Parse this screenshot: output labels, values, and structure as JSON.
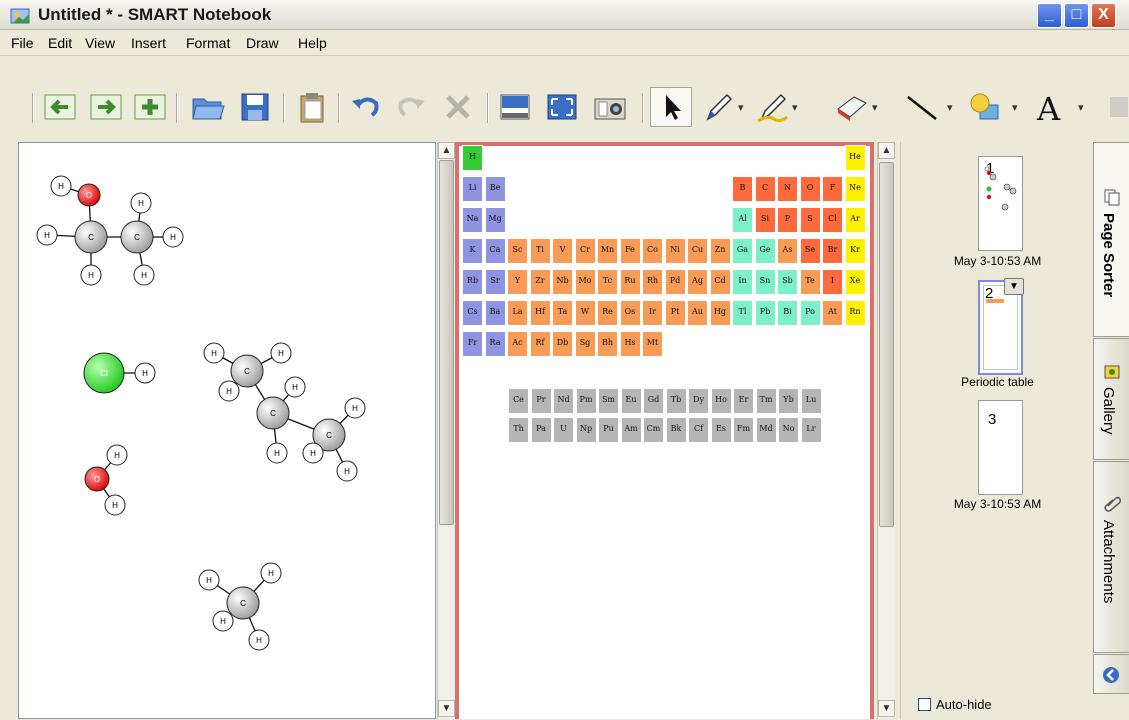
{
  "window": {
    "title": "Untitled * - SMART Notebook",
    "buttons": {
      "minimize": "_",
      "maximize": "□",
      "close": "X"
    }
  },
  "menu": [
    "File",
    "Edit",
    "View",
    "Insert",
    "Format",
    "Draw",
    "Help"
  ],
  "toolbar": {
    "icons": [
      "back-arrow-icon",
      "forward-arrow-icon",
      "add-page-icon",
      "open-folder-icon",
      "save-icon",
      "paste-icon",
      "undo-icon",
      "redo-icon",
      "delete-icon",
      "screen-shade-icon",
      "full-screen-icon",
      "capture-icon",
      "select-icon",
      "pen-icon",
      "creative-pen-icon",
      "eraser-icon",
      "line-icon",
      "shapes-icon",
      "text-icon"
    ]
  },
  "pages": [
    {
      "number": "1",
      "caption": "May 3-10:53 AM"
    },
    {
      "number": "2",
      "caption": "Periodic table"
    },
    {
      "number": "3",
      "caption": "May 3-10:53 AM"
    }
  ],
  "side_tabs": [
    "Page Sorter",
    "Gallery",
    "Attachments"
  ],
  "autohide_label": "Auto-hide",
  "molecules": {
    "h": "H",
    "c": "C",
    "o": "O",
    "cl": "Cl"
  },
  "periodic_table": {
    "main": [
      [
        {
          "s": "H",
          "c": "h",
          "col": 0
        },
        {
          "s": "He",
          "c": "n",
          "col": 17
        }
      ],
      [
        {
          "s": "Li",
          "c": "s",
          "col": 0
        },
        {
          "s": "Be",
          "c": "s",
          "col": 1
        },
        {
          "s": "B",
          "c": "p",
          "col": 12
        },
        {
          "s": "C",
          "c": "p",
          "col": 13
        },
        {
          "s": "N",
          "c": "p",
          "col": 14
        },
        {
          "s": "O",
          "c": "p",
          "col": 15
        },
        {
          "s": "F",
          "c": "p",
          "col": 16
        },
        {
          "s": "Ne",
          "c": "n",
          "col": 17
        }
      ],
      [
        {
          "s": "Na",
          "c": "s",
          "col": 0
        },
        {
          "s": "Mg",
          "c": "s",
          "col": 1
        },
        {
          "s": "Al",
          "c": "m",
          "col": 12
        },
        {
          "s": "Si",
          "c": "p",
          "col": 13
        },
        {
          "s": "P",
          "c": "p",
          "col": 14
        },
        {
          "s": "S",
          "c": "p",
          "col": 15
        },
        {
          "s": "Cl",
          "c": "p",
          "col": 16
        },
        {
          "s": "Ar",
          "c": "n",
          "col": 17
        }
      ],
      [
        {
          "s": "K",
          "c": "s",
          "col": 0
        },
        {
          "s": "Ca",
          "c": "s",
          "col": 1
        },
        {
          "s": "Sc",
          "c": "t",
          "col": 2
        },
        {
          "s": "Ti",
          "c": "t",
          "col": 3
        },
        {
          "s": "V",
          "c": "t",
          "col": 4
        },
        {
          "s": "Cr",
          "c": "t",
          "col": 5
        },
        {
          "s": "Mn",
          "c": "t",
          "col": 6
        },
        {
          "s": "Fe",
          "c": "t",
          "col": 7
        },
        {
          "s": "Co",
          "c": "t",
          "col": 8
        },
        {
          "s": "Ni",
          "c": "t",
          "col": 9
        },
        {
          "s": "Cu",
          "c": "t",
          "col": 10
        },
        {
          "s": "Zn",
          "c": "t",
          "col": 11
        },
        {
          "s": "Ga",
          "c": "m",
          "col": 12
        },
        {
          "s": "Ge",
          "c": "m",
          "col": 13
        },
        {
          "s": "As",
          "c": "t",
          "col": 14
        },
        {
          "s": "Se",
          "c": "p",
          "col": 15
        },
        {
          "s": "Br",
          "c": "p",
          "col": 16
        },
        {
          "s": "Kr",
          "c": "n",
          "col": 17
        }
      ],
      [
        {
          "s": "Rb",
          "c": "s",
          "col": 0
        },
        {
          "s": "Sr",
          "c": "s",
          "col": 1
        },
        {
          "s": "Y",
          "c": "t",
          "col": 2
        },
        {
          "s": "Zr",
          "c": "t",
          "col": 3
        },
        {
          "s": "Nb",
          "c": "t",
          "col": 4
        },
        {
          "s": "Mo",
          "c": "t",
          "col": 5
        },
        {
          "s": "Tc",
          "c": "t",
          "col": 6
        },
        {
          "s": "Ru",
          "c": "t",
          "col": 7
        },
        {
          "s": "Rh",
          "c": "t",
          "col": 8
        },
        {
          "s": "Pd",
          "c": "t",
          "col": 9
        },
        {
          "s": "Ag",
          "c": "t",
          "col": 10
        },
        {
          "s": "Cd",
          "c": "t",
          "col": 11
        },
        {
          "s": "In",
          "c": "m",
          "col": 12
        },
        {
          "s": "Sn",
          "c": "m",
          "col": 13
        },
        {
          "s": "Sb",
          "c": "m",
          "col": 14
        },
        {
          "s": "Te",
          "c": "t",
          "col": 15
        },
        {
          "s": "I",
          "c": "p",
          "col": 16
        },
        {
          "s": "Xe",
          "c": "n",
          "col": 17
        }
      ],
      [
        {
          "s": "Cs",
          "c": "s",
          "col": 0
        },
        {
          "s": "Ba",
          "c": "s",
          "col": 1
        },
        {
          "s": "La",
          "c": "t",
          "col": 2
        },
        {
          "s": "Hf",
          "c": "t",
          "col": 3
        },
        {
          "s": "Ta",
          "c": "t",
          "col": 4
        },
        {
          "s": "W",
          "c": "t",
          "col": 5
        },
        {
          "s": "Re",
          "c": "t",
          "col": 6
        },
        {
          "s": "Os",
          "c": "t",
          "col": 7
        },
        {
          "s": "Ir",
          "c": "t",
          "col": 8
        },
        {
          "s": "Pt",
          "c": "t",
          "col": 9
        },
        {
          "s": "Au",
          "c": "t",
          "col": 10
        },
        {
          "s": "Hg",
          "c": "t",
          "col": 11
        },
        {
          "s": "Tl",
          "c": "m",
          "col": 12
        },
        {
          "s": "Pb",
          "c": "m",
          "col": 13
        },
        {
          "s": "Bi",
          "c": "m",
          "col": 14
        },
        {
          "s": "Po",
          "c": "m",
          "col": 15
        },
        {
          "s": "At",
          "c": "t",
          "col": 16
        },
        {
          "s": "Rn",
          "c": "n",
          "col": 17
        }
      ],
      [
        {
          "s": "Fr",
          "c": "s",
          "col": 0
        },
        {
          "s": "Ra",
          "c": "s",
          "col": 1
        },
        {
          "s": "Ac",
          "c": "t",
          "col": 2
        },
        {
          "s": "Rf",
          "c": "t",
          "col": 3
        },
        {
          "s": "Db",
          "c": "t",
          "col": 4
        },
        {
          "s": "Sg",
          "c": "t",
          "col": 5
        },
        {
          "s": "Bh",
          "c": "t",
          "col": 6
        },
        {
          "s": "Hs",
          "c": "t",
          "col": 7
        },
        {
          "s": "Mt",
          "c": "t",
          "col": 8
        }
      ]
    ],
    "lanthanides": [
      "Ce",
      "Pr",
      "Nd",
      "Pm",
      "Sm",
      "Eu",
      "Gd",
      "Tb",
      "Dy",
      "Ho",
      "Er",
      "Tm",
      "Yb",
      "Lu"
    ],
    "actinides": [
      "Th",
      "Pa",
      "U",
      "Np",
      "Pu",
      "Am",
      "Cm",
      "Bk",
      "Cf",
      "Es",
      "Fm",
      "Md",
      "No",
      "Lr"
    ]
  }
}
